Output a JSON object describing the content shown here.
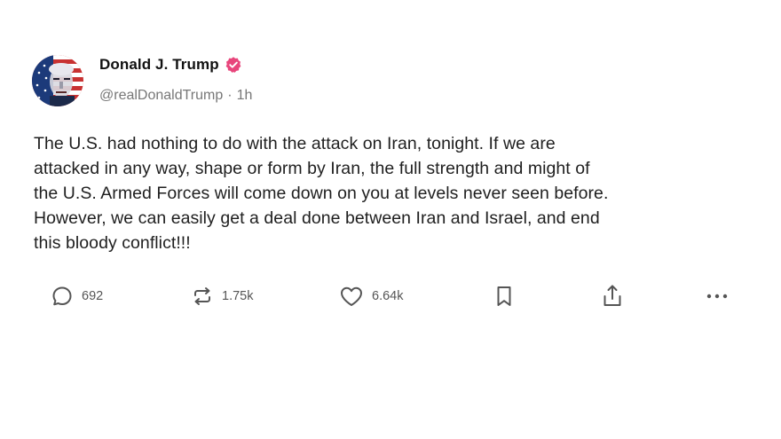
{
  "author": {
    "display_name": "Donald J. Trump",
    "handle": "@realDonaldTrump",
    "separator": "·",
    "timestamp": "1h",
    "verified": true,
    "verified_color": "#e8467c"
  },
  "post": {
    "lines": [
      "The U.S. had nothing to do with the attack on Iran, tonight. If we are",
      "attacked in any way, shape or form by Iran, the full strength and might of",
      "the U.S. Armed Forces will come down on you at levels never seen before.",
      "However, we can easily get a deal done between Iran and Israel, and end",
      "this bloody conflict!!!"
    ]
  },
  "actions": {
    "reply": {
      "icon": "reply-icon",
      "count": "692"
    },
    "repost": {
      "icon": "repost-icon",
      "count": "1.75k"
    },
    "like": {
      "icon": "heart-icon",
      "count": "6.64k"
    },
    "bookmark": {
      "icon": "bookmark-icon"
    },
    "share": {
      "icon": "share-icon"
    },
    "more": {
      "icon": "more-icon"
    }
  },
  "colors": {
    "text": "#1f1f1f",
    "muted": "#777777",
    "icon": "#555555"
  }
}
